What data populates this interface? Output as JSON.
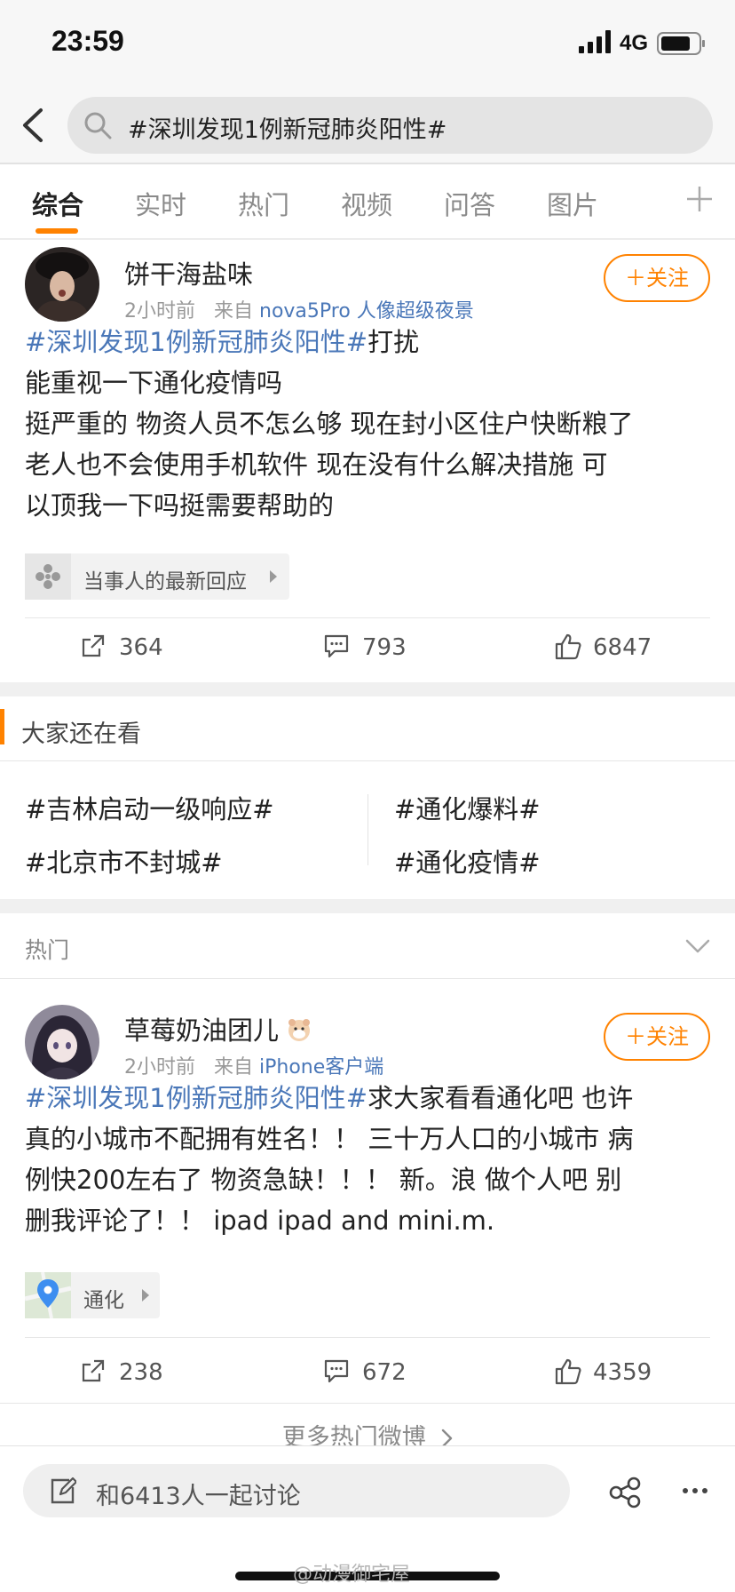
{
  "status_bar": {
    "time": "23:59",
    "network": "4G"
  },
  "search": {
    "query": "#深圳发现1例新冠肺炎阳性#"
  },
  "tabs": [
    {
      "label": "综合",
      "active": true
    },
    {
      "label": "实时"
    },
    {
      "label": "热门"
    },
    {
      "label": "视频"
    },
    {
      "label": "问答"
    },
    {
      "label": "图片"
    }
  ],
  "post1": {
    "username": "饼干海盐味",
    "time": "2小时前",
    "source_prefix": "来自",
    "source": "nova5Pro 人像超级夜景",
    "follow_label": "＋关注",
    "hashtag": "#深圳发现1例新冠肺炎阳性#",
    "text_lines": [
      "打扰",
      "能重视一下通化疫情吗",
      "挺严重的 物资人员不怎么够 现在封小区住户快断粮了",
      "老人也不会使用手机软件 现在没有什么解决措施   可",
      "以顶我一下吗挺需要帮助的"
    ],
    "chip_label": "当事人的最新回应",
    "reposts": "364",
    "comments": "793",
    "likes": "6847"
  },
  "also_watching": {
    "title": "大家还在看",
    "tags": [
      "#吉林启动一级响应#",
      "#通化爆料#",
      "#北京市不封城#",
      "#通化疫情#"
    ]
  },
  "hot_section": {
    "label": "热门"
  },
  "post2": {
    "username": "草莓奶油团儿",
    "time": "2小时前",
    "source_prefix": "来自",
    "source": "iPhone客户端",
    "follow_label": "＋关注",
    "hashtag": "#深圳发现1例新冠肺炎阳性#",
    "text_first": "求大家看看通化吧 也许",
    "text_lines": [
      "真的小城市不配拥有姓名！！ 三十万人口的小城市 病",
      "例快200左右了 物资急缺！！！ 新。浪 做个人吧 别",
      "删我评论了！！ ipad ipad and mini.m."
    ],
    "location": "通化",
    "reposts": "238",
    "comments": "672",
    "likes": "4359"
  },
  "more_hot": "更多热门微博",
  "bottom": {
    "discuss": "和6413人一起讨论"
  },
  "watermark": "@动漫御宅屋",
  "colors": {
    "accent": "#ff8200",
    "link": "#4a77b8"
  }
}
